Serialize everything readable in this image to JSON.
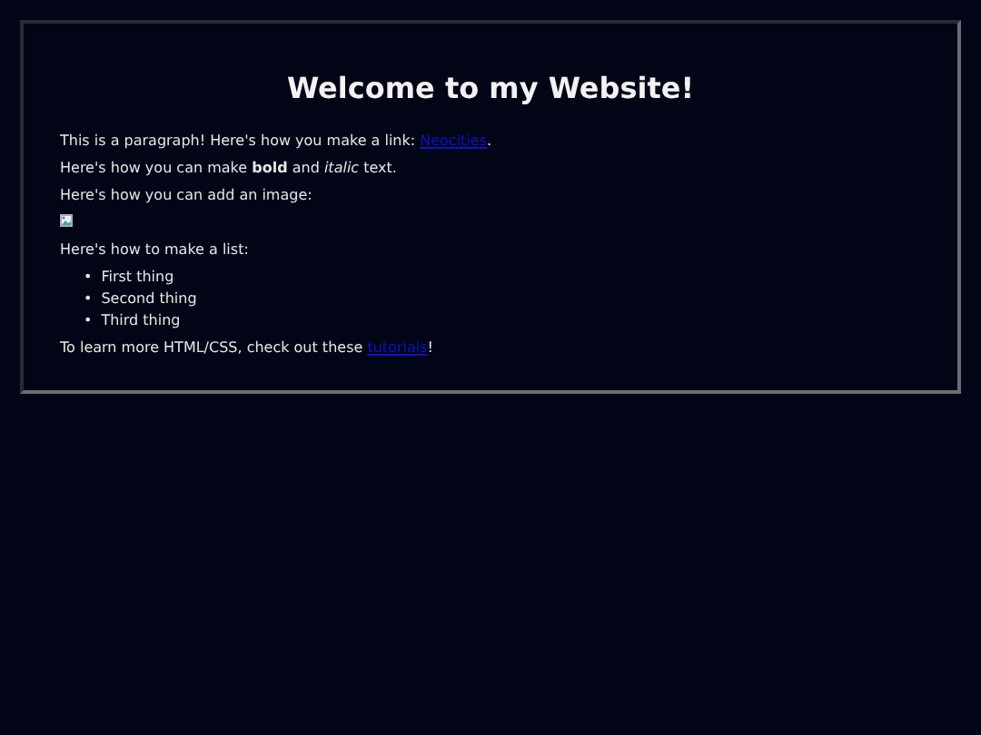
{
  "heading": "Welcome to my Website!",
  "blocks": [
    {
      "kind": "paragraph",
      "text": "This is a paragraph! Here's how you make a link: ",
      "link": "Neocities",
      "after": "."
    },
    {
      "kind": "paragraph",
      "text": "Here's how you can make **bold** and *italic* text."
    },
    {
      "kind": "paragraph",
      "text": "Here's how you can add an image:"
    },
    {
      "kind": "image"
    },
    {
      "kind": "paragraph",
      "text": "Here's how to make a list:"
    },
    {
      "kind": "list",
      "marker": "•",
      "items": [
        "First thing",
        "Second thing",
        "Third thing"
      ]
    },
    {
      "kind": "paragraph",
      "text": "To learn more HTML/CSS, check out these ",
      "link": "tutorials",
      "after": "!"
    }
  ]
}
